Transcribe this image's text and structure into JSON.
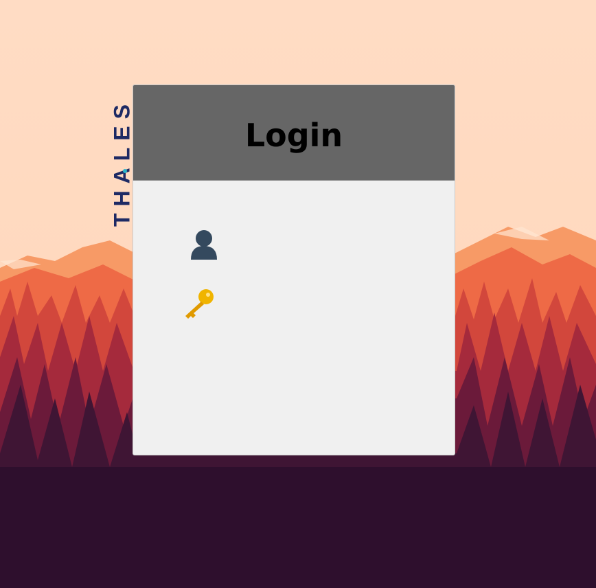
{
  "app": {
    "brand": "THALES"
  },
  "login": {
    "title": "Login",
    "username": {
      "icon": "user-icon",
      "value": "",
      "placeholder": ""
    },
    "password": {
      "icon": "key-icon",
      "value": "",
      "placeholder": ""
    }
  },
  "colors": {
    "sky": "#ffdcc4",
    "header_bg": "#666666",
    "card_bg": "#f0f0f0",
    "brand_text": "#1e2a64",
    "brand_accent": "#2ab3c9",
    "user_icon": "#34495e",
    "key_icon": "#f0b400",
    "ground": "#2e0f2d"
  }
}
